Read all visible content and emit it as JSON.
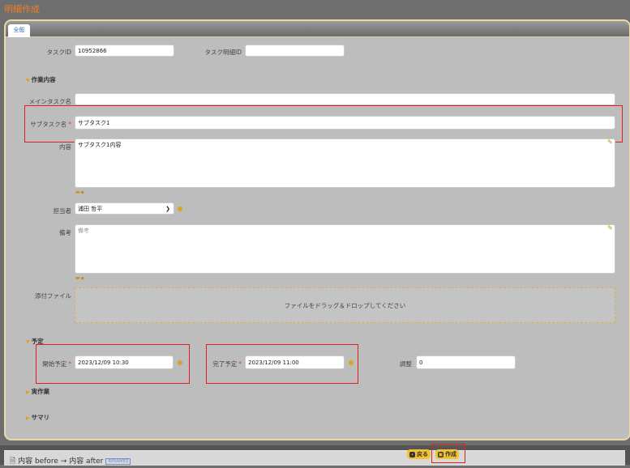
{
  "page": {
    "title": "明細作成"
  },
  "tabs": [
    {
      "label": "全般"
    }
  ],
  "fields": {
    "task_id_label": "タスクID",
    "task_id_value": "10952866",
    "task_detail_id_label": "タスク明細ID",
    "task_detail_id_value": "",
    "section_work": "作業内容",
    "main_task_label": "メインタスク名",
    "main_task_value": "",
    "sub_task_label": "サブタスク名",
    "sub_task_value": "サブタスク1",
    "content_label": "内容",
    "content_value": "サブタスク1内容",
    "assignee_label": "担当者",
    "assignee_value": "浦田 哲平",
    "remarks_label": "備考",
    "remarks_placeholder": "備考",
    "attachment_label": "添付ファイル",
    "dropzone_text": "ファイルをドラッグ＆ドロップしてください",
    "section_schedule": "予定",
    "start_label": "開始予定",
    "start_value": "2023/12/09 10:30",
    "end_label": "完了予定",
    "end_value": "2023/12/09 11:00",
    "adjust_label": "調整",
    "adjust_value": "0",
    "section_actual": "実作業",
    "section_summary": "サマリ",
    "required_mark": "*"
  },
  "footer": {
    "back_label": "戻る",
    "create_label": "作成",
    "notice": "内容 before → 内容 after",
    "badge": "RENAMED"
  },
  "colors": {
    "accent": "#f3c32f",
    "title": "#f07d2a",
    "highlight": "#e0201e"
  }
}
